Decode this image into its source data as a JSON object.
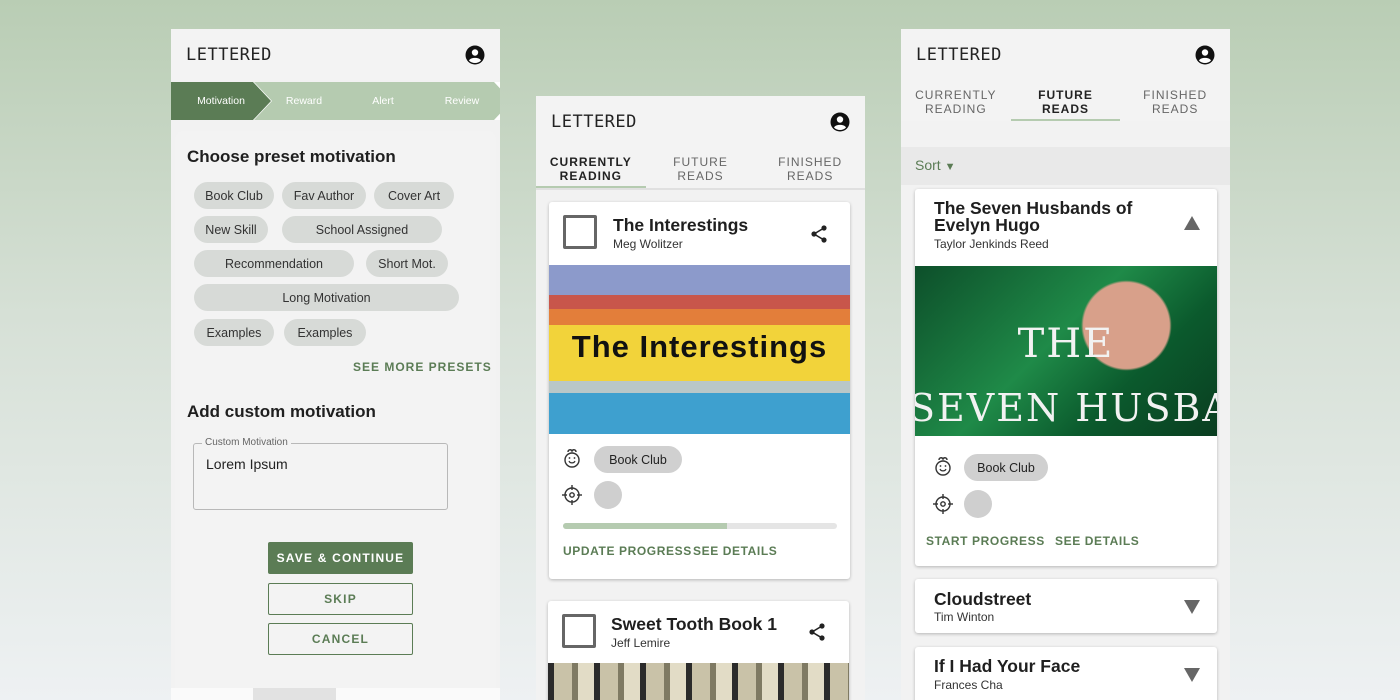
{
  "colors": {
    "accent": "#5b7c55",
    "accent_light": "#b5cbb0",
    "chip": "#d7dad7"
  },
  "screen1": {
    "logo": "LETTERED",
    "steps": [
      "Motivation",
      "Reward",
      "Alert",
      "Review"
    ],
    "preset_heading": "Choose preset motivation",
    "presets": [
      "Book Club",
      "Fav Author",
      "Cover Art",
      "New Skill",
      "School Assigned",
      "Recommendation",
      "Short Mot.",
      "Long Motivation",
      "Examples",
      "Examples"
    ],
    "see_more": "SEE MORE PRESETS",
    "custom_heading": "Add custom motivation",
    "custom_label": "Custom Motivation",
    "custom_value": "Lorem Ipsum",
    "save_btn": "SAVE & CONTINUE",
    "skip_btn": "SKIP",
    "cancel_btn": "CANCEL"
  },
  "screen2": {
    "logo": "LETTERED",
    "tabs": [
      "CURRENTLY\nREADING",
      "FUTURE\nREADS",
      "FINISHED\nREADS"
    ],
    "books": [
      {
        "title": "The Interestings",
        "author": "Meg Wolitzer",
        "cover_text": "The Interestings",
        "motivation": "Book Club",
        "progress": 0.6,
        "update": "UPDATE PROGRESS",
        "details": "SEE DETAILS"
      },
      {
        "title": "Sweet Tooth Book 1",
        "author": "Jeff Lemire"
      }
    ]
  },
  "screen3": {
    "logo": "LETTERED",
    "tabs": [
      "CURRENTLY\nREADING",
      "FUTURE\nREADS",
      "FINISHED\nREADS"
    ],
    "sort": "Sort",
    "books": [
      {
        "title": "The Seven Husbands of Evelyn Hugo",
        "author": "Taylor Jenkinds Reed",
        "cover_line1": "THE",
        "cover_line2": "SEVEN HUSBANDS",
        "motivation": "Book Club",
        "start": "START PROGRESS",
        "details": "SEE DETAILS"
      },
      {
        "title": "Cloudstreet",
        "author": "Tim Winton"
      },
      {
        "title": "If I Had Your Face",
        "author": "Frances Cha"
      }
    ]
  }
}
